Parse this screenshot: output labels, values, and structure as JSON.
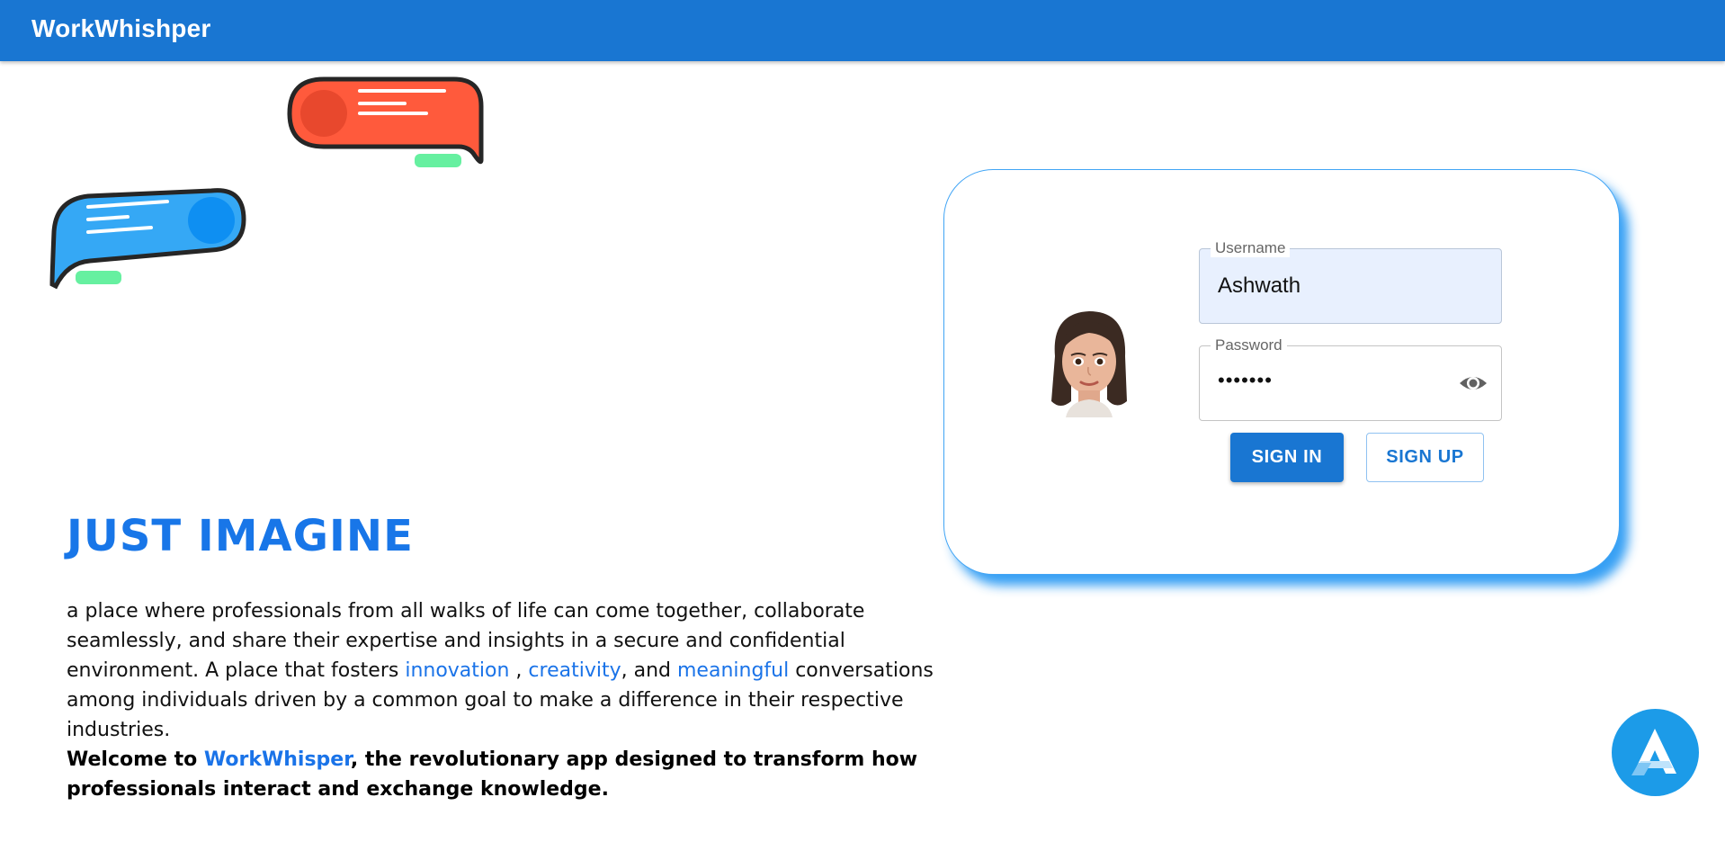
{
  "app": {
    "title": "WorkWhishper"
  },
  "hero": {
    "title": "JUST IMAGINE",
    "paragraph": {
      "part1": "a place where professionals from all walks of life can come together, collaborate seamlessly, and share their expertise and insights in a secure and confidential environment. A place that fosters ",
      "highlight1": "innovation",
      "sep1": " , ",
      "highlight2": "creativity",
      "sep2": ", and ",
      "highlight3": "meaningful",
      "part2": " conversations among individuals driven by a common goal to make a difference in their respective industries."
    },
    "welcome": {
      "prefix": "Welcome to ",
      "brand": "WorkWhisper",
      "suffix": ", the revolutionary app designed to transform how professionals interact and exchange knowledge."
    }
  },
  "login": {
    "username": {
      "label": "Username",
      "value": "Ashwath"
    },
    "password": {
      "label": "Password",
      "value": "•••••••"
    },
    "signin_label": "SIGN IN",
    "signup_label": "SIGN UP"
  },
  "icons": {
    "avatar": "memoji-avatar-icon",
    "eye": "visibility-eye-icon",
    "fab": "assistant-logo-icon",
    "bubbles": "chat-bubble-icon"
  },
  "colors": {
    "primary": "#1976d2",
    "accent": "#1a73e8",
    "bubble_red": "#ff5a3c",
    "bubble_blue": "#35a8f5",
    "bubble_green": "#66f0a0"
  }
}
